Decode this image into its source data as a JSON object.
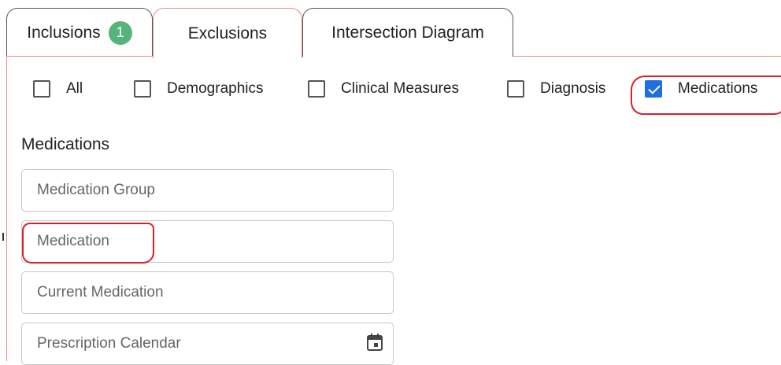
{
  "tabs": {
    "inclusions": {
      "label": "Inclusions",
      "badge": "1"
    },
    "exclusions": {
      "label": "Exclusions"
    },
    "intersection": {
      "label": "Intersection Diagram"
    }
  },
  "filters": {
    "all": {
      "label": "All",
      "checked": false
    },
    "demographics": {
      "label": "Demographics",
      "checked": false
    },
    "clinical_measures": {
      "label": "Clinical Measures",
      "checked": false
    },
    "diagnosis": {
      "label": "Diagnosis",
      "checked": false
    },
    "medications": {
      "label": "Medications",
      "checked": true
    }
  },
  "section": {
    "title": "Medications"
  },
  "fields": {
    "medication_group": {
      "placeholder": "Medication Group",
      "value": ""
    },
    "medication": {
      "placeholder": "Medication",
      "value": ""
    },
    "current_medication": {
      "placeholder": "Current Medication",
      "value": ""
    },
    "prescription_calendar": {
      "placeholder": "Prescription Calendar",
      "value": "",
      "icon": "calendar-icon"
    }
  },
  "colors": {
    "active_tab_border": "#e98a8a",
    "badge": "#55b37c",
    "checkbox_checked": "#1e6fe0",
    "annotation": "#d9202a"
  }
}
